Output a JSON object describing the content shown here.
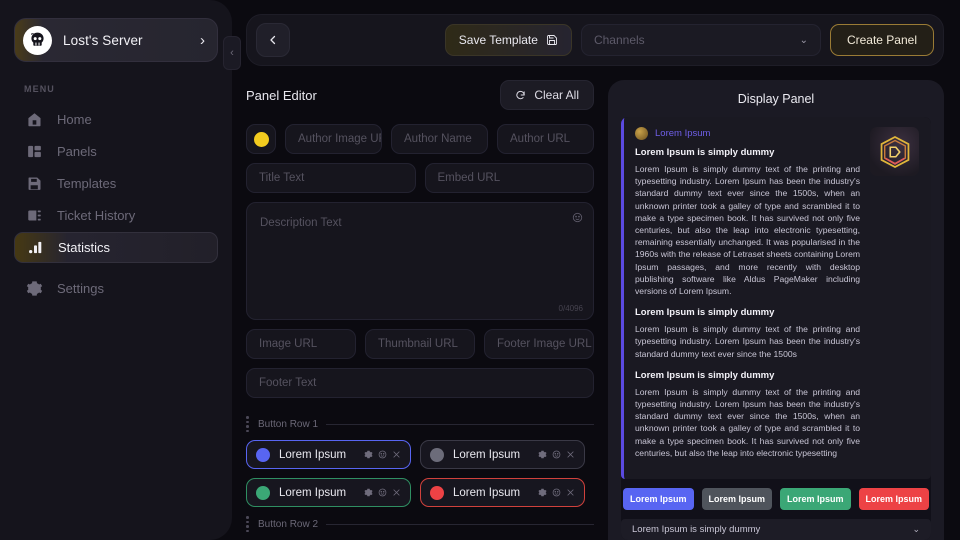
{
  "sidebar": {
    "server": {
      "name": "Lost's Server",
      "avatar_icon": "skull-avatar",
      "chevron": "›"
    },
    "menu_label": "MENU",
    "items": [
      {
        "label": "Home",
        "icon": "home-icon",
        "active": false
      },
      {
        "label": "Panels",
        "icon": "panels-icon",
        "active": false
      },
      {
        "label": "Templates",
        "icon": "templates-icon",
        "active": false
      },
      {
        "label": "Ticket History",
        "icon": "ticket-history-icon",
        "active": false
      },
      {
        "label": "Statistics",
        "icon": "statistics-icon",
        "active": true
      },
      {
        "label": "Settings",
        "icon": "settings-gear-icon",
        "active": false
      }
    ],
    "collapse_chevron": "‹"
  },
  "topbar": {
    "back_icon": "chevron-left-icon",
    "save_template_label": "Save Template",
    "save_template_icon": "save-disk-icon",
    "channels_placeholder": "Channels",
    "channels_chevron": "⌄",
    "create_panel_label": "Create Panel"
  },
  "editor": {
    "title": "Panel Editor",
    "clear_all_label": "Clear All",
    "clear_all_icon": "refresh-icon",
    "color_swatch": "#f2cb1f",
    "author_image_url_placeholder": "Author Image URL",
    "author_name_placeholder": "Author Name",
    "author_url_placeholder": "Author URL",
    "title_text_placeholder": "Title Text",
    "embed_url_placeholder": "Embed URL",
    "description_placeholder": "Description Text",
    "description_counter": "0/4096",
    "description_emoji_icon": "emoji-icon",
    "image_url_placeholder": "Image URL",
    "thumbnail_url_placeholder": "Thumbnail URL",
    "footer_image_url_placeholder": "Footer Image URL",
    "footer_text_placeholder": "Footer Text",
    "button_row_1_label": "Button Row 1",
    "button_row_2_label": "Button Row 2",
    "buttons": [
      {
        "label": "Lorem Ipsum",
        "color": "#5865f2",
        "style": "b-blurple"
      },
      {
        "label": "Lorem Ipsum",
        "color": "#6c6c7a",
        "style": "b-grey"
      },
      {
        "label": "Lorem Ipsum",
        "color": "#3ba776",
        "style": "b-green"
      },
      {
        "label": "Lorem Ipsum",
        "color": "#ed4245",
        "style": "b-red"
      }
    ],
    "button_action_icons": [
      "gear-icon",
      "emoji-icon",
      "close-icon"
    ]
  },
  "preview": {
    "title": "Display Panel",
    "accent_color": "#5b4ae0",
    "author_name": "Lorem Ipsum",
    "thumbnail_icon": "card-emblem-icon",
    "blocks": [
      {
        "heading": "Lorem Ipsum is simply dummy",
        "text": "Lorem Ipsum is simply dummy text of the printing and typesetting industry. Lorem Ipsum has been the industry's standard dummy text ever since the 1500s, when an unknown printer took a galley of type and scrambled it to make a type specimen book. It has survived not only five centuries, but also the leap into electronic typesetting, remaining essentially unchanged. It was popularised in the 1960s with the release of Letraset sheets containing Lorem Ipsum passages, and more recently with desktop publishing software like Aldus PageMaker including versions of Lorem Ipsum."
      },
      {
        "heading": "Lorem Ipsum is simply dummy",
        "text": "Lorem Ipsum is simply dummy text of the printing and typesetting industry. Lorem Ipsum has been the industry's standard dummy text ever since the 1500s"
      },
      {
        "heading": "Lorem Ipsum is simply dummy",
        "text": "Lorem Ipsum is simply dummy text of the printing and typesetting industry. Lorem Ipsum has been the industry's standard dummy text ever since the 1500s, when an unknown printer took a galley of type and scrambled it to make a type specimen book. It has survived not only five centuries, but also the leap into electronic typesetting"
      }
    ],
    "buttons": [
      {
        "label": "Lorem Ipsum",
        "color": "#5865f2"
      },
      {
        "label": "Lorem Ipsum",
        "color": "#4f545c"
      },
      {
        "label": "Lorem Ipsum",
        "color": "#3ba776"
      },
      {
        "label": "Lorem Ipsum",
        "color": "#ed4245"
      }
    ],
    "select_text": "Lorem Ipsum is simply dummy",
    "select_chevron": "⌄"
  }
}
